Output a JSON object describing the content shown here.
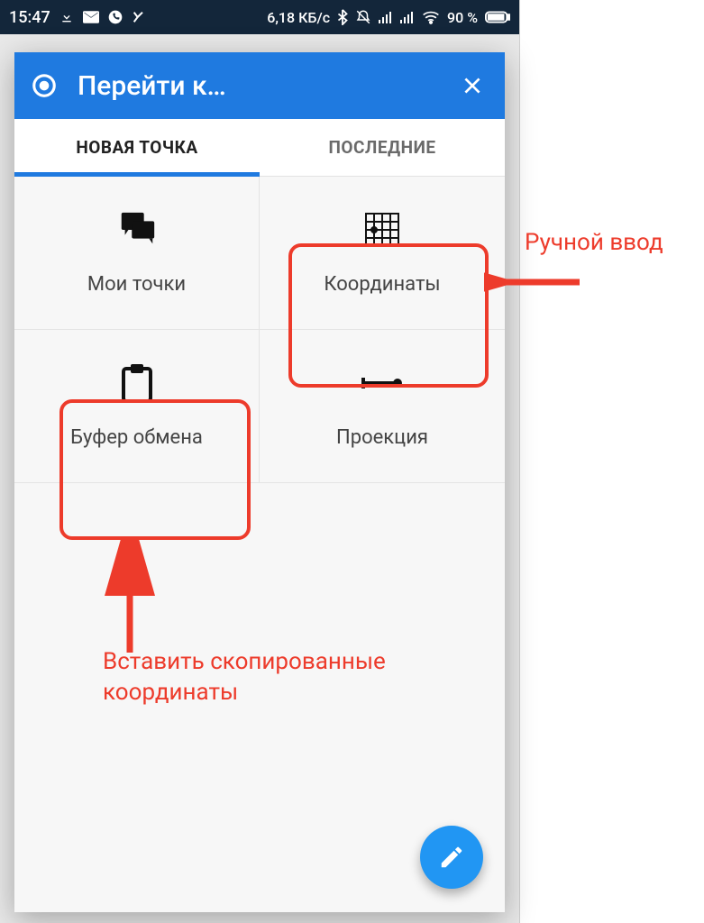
{
  "statusbar": {
    "time": "15:47",
    "data_rate": "6,18 КБ/с",
    "battery": "90 %"
  },
  "sheet": {
    "title": "Перейти к…",
    "tabs": {
      "new_point": "НОВАЯ ТОЧКА",
      "recent": "ПОСЛЕДНИЕ"
    },
    "items": {
      "my_points": "Мои точки",
      "coordinates": "Координаты",
      "clipboard": "Буфер обмена",
      "projection": "Проекция"
    }
  },
  "annotations": {
    "manual_input": "Ручной ввод",
    "paste_coords": "Вставить скопированные координаты"
  }
}
